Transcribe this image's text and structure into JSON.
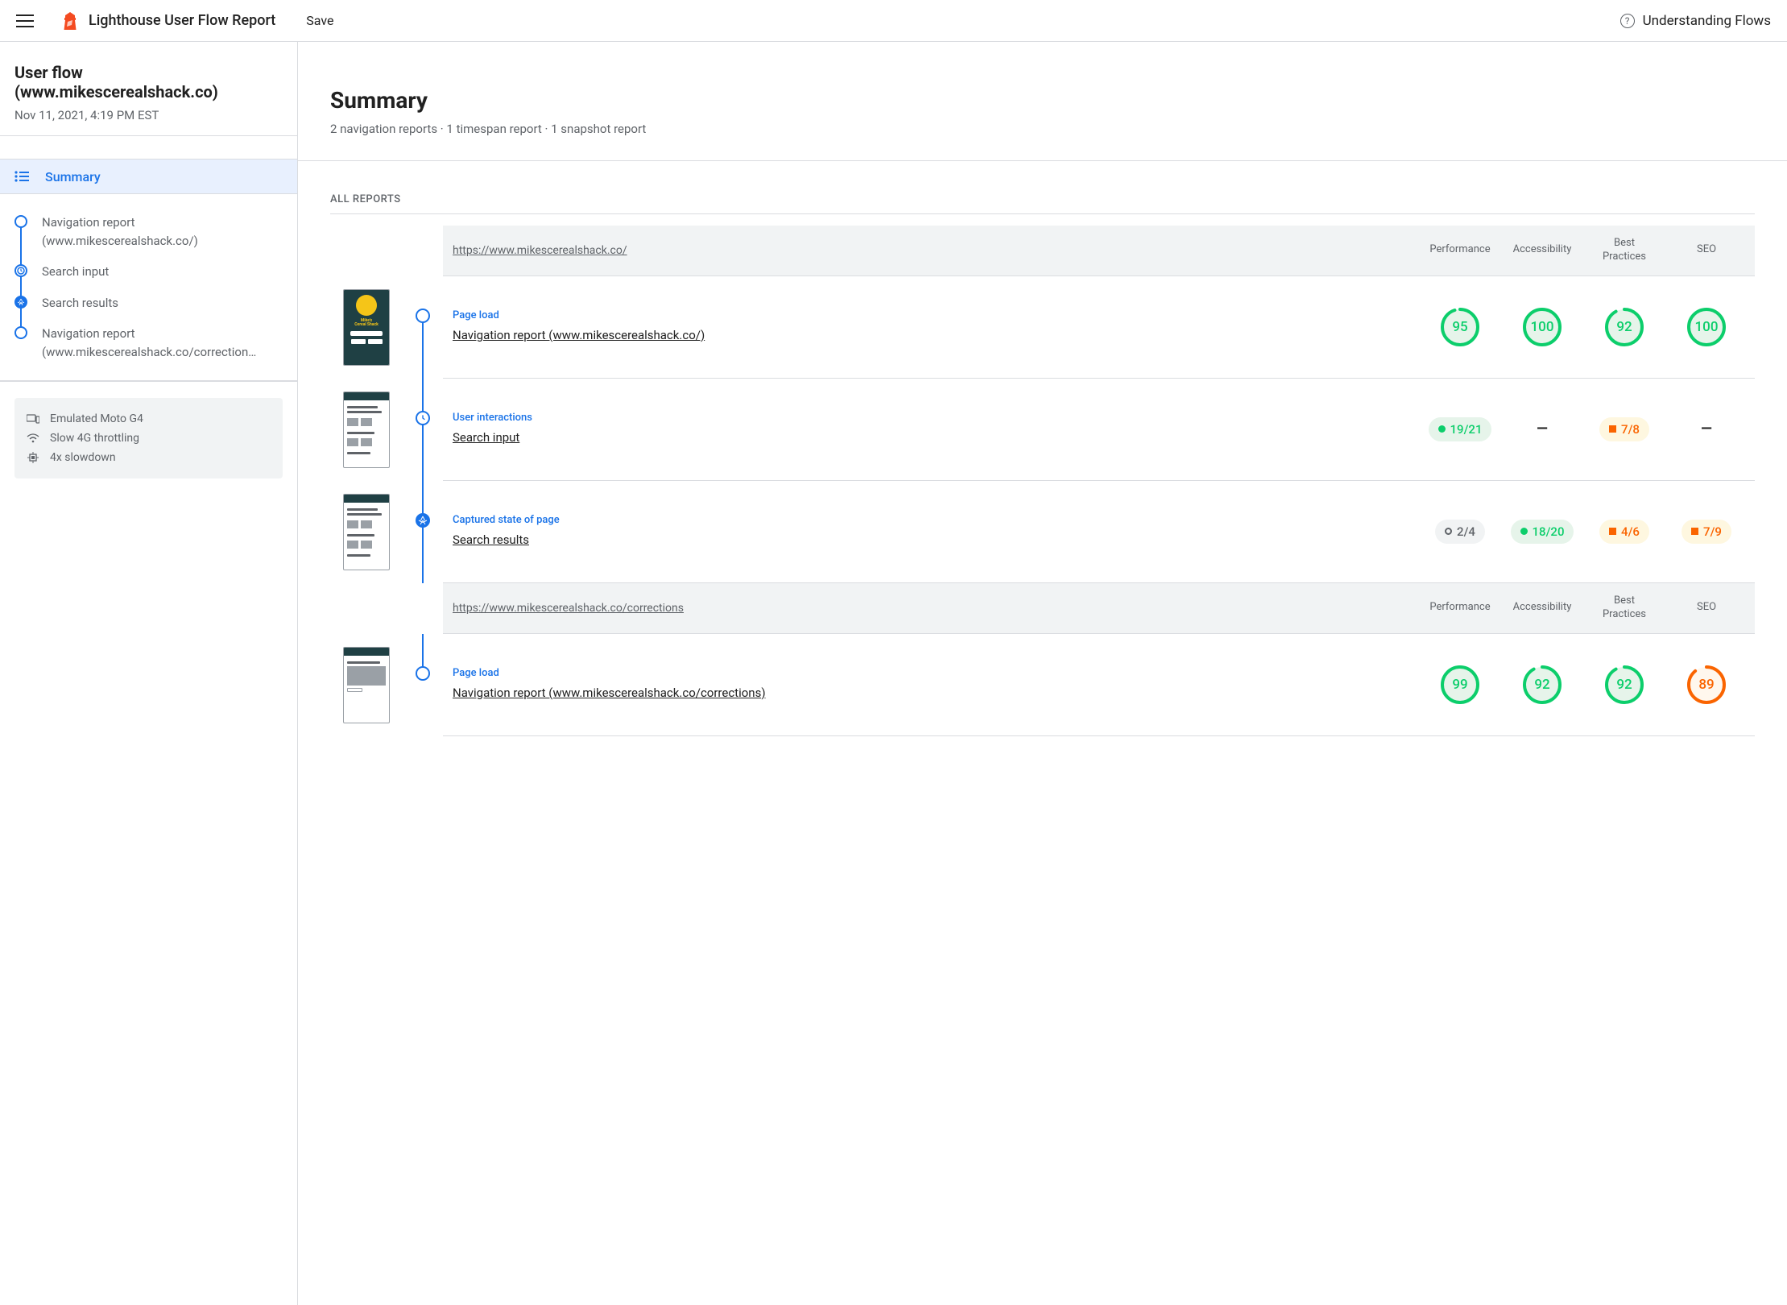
{
  "topbar": {
    "title": "Lighthouse User Flow Report",
    "save": "Save",
    "understanding": "Understanding Flows"
  },
  "sidebar": {
    "flow_title": "User flow (www.mikescerealshack.co)",
    "date": "Nov 11, 2021, 4:19 PM EST",
    "summary_label": "Summary",
    "steps": [
      {
        "label": "Navigation report (www.mikescerealshack.co/)",
        "icon": "circle"
      },
      {
        "label": "Search input",
        "icon": "clock"
      },
      {
        "label": "Search results",
        "icon": "aperture"
      },
      {
        "label": "Navigation report (www.mikescerealshack.co/correction…",
        "icon": "circle"
      }
    ],
    "env": {
      "device": "Emulated Moto G4",
      "throttle": "Slow 4G throttling",
      "cpu": "4x slowdown"
    }
  },
  "summary": {
    "heading": "Summary",
    "sub": "2 navigation reports · 1 timespan report · 1 snapshot report",
    "all_reports": "ALL REPORTS"
  },
  "metrics": [
    "Performance",
    "Accessibility",
    "Best Practices",
    "SEO"
  ],
  "groups": [
    {
      "url": "https://www.mikescerealshack.co/",
      "rows": [
        {
          "kind": "Page load",
          "name": "Navigation report (www.mikescerealshack.co/)",
          "node": "circle",
          "scores": [
            {
              "type": "gauge",
              "value": 95,
              "color": "green"
            },
            {
              "type": "gauge",
              "value": 100,
              "color": "green"
            },
            {
              "type": "gauge",
              "value": 92,
              "color": "green"
            },
            {
              "type": "gauge",
              "value": 100,
              "color": "green"
            }
          ]
        },
        {
          "kind": "User interactions",
          "name": "Search input",
          "node": "clock",
          "scores": [
            {
              "type": "pill",
              "value": "19/21",
              "color": "green",
              "marker": "dot"
            },
            {
              "type": "dash"
            },
            {
              "type": "pill",
              "value": "7/8",
              "color": "orange",
              "marker": "sq"
            },
            {
              "type": "dash"
            }
          ]
        },
        {
          "kind": "Captured state of page",
          "name": "Search results",
          "node": "aperture",
          "scores": [
            {
              "type": "pill",
              "value": "2/4",
              "color": "gray",
              "marker": "ring"
            },
            {
              "type": "pill",
              "value": "18/20",
              "color": "green",
              "marker": "dot"
            },
            {
              "type": "pill",
              "value": "4/6",
              "color": "orange",
              "marker": "sq"
            },
            {
              "type": "pill",
              "value": "7/9",
              "color": "orange",
              "marker": "sq"
            }
          ]
        }
      ]
    },
    {
      "url": "https://www.mikescerealshack.co/corrections",
      "rows": [
        {
          "kind": "Page load",
          "name": "Navigation report (www.mikescerealshack.co/corrections)",
          "node": "circle",
          "scores": [
            {
              "type": "gauge",
              "value": 99,
              "color": "green"
            },
            {
              "type": "gauge",
              "value": 92,
              "color": "green"
            },
            {
              "type": "gauge",
              "value": 92,
              "color": "green"
            },
            {
              "type": "gauge",
              "value": 89,
              "color": "orange"
            }
          ]
        }
      ]
    }
  ]
}
